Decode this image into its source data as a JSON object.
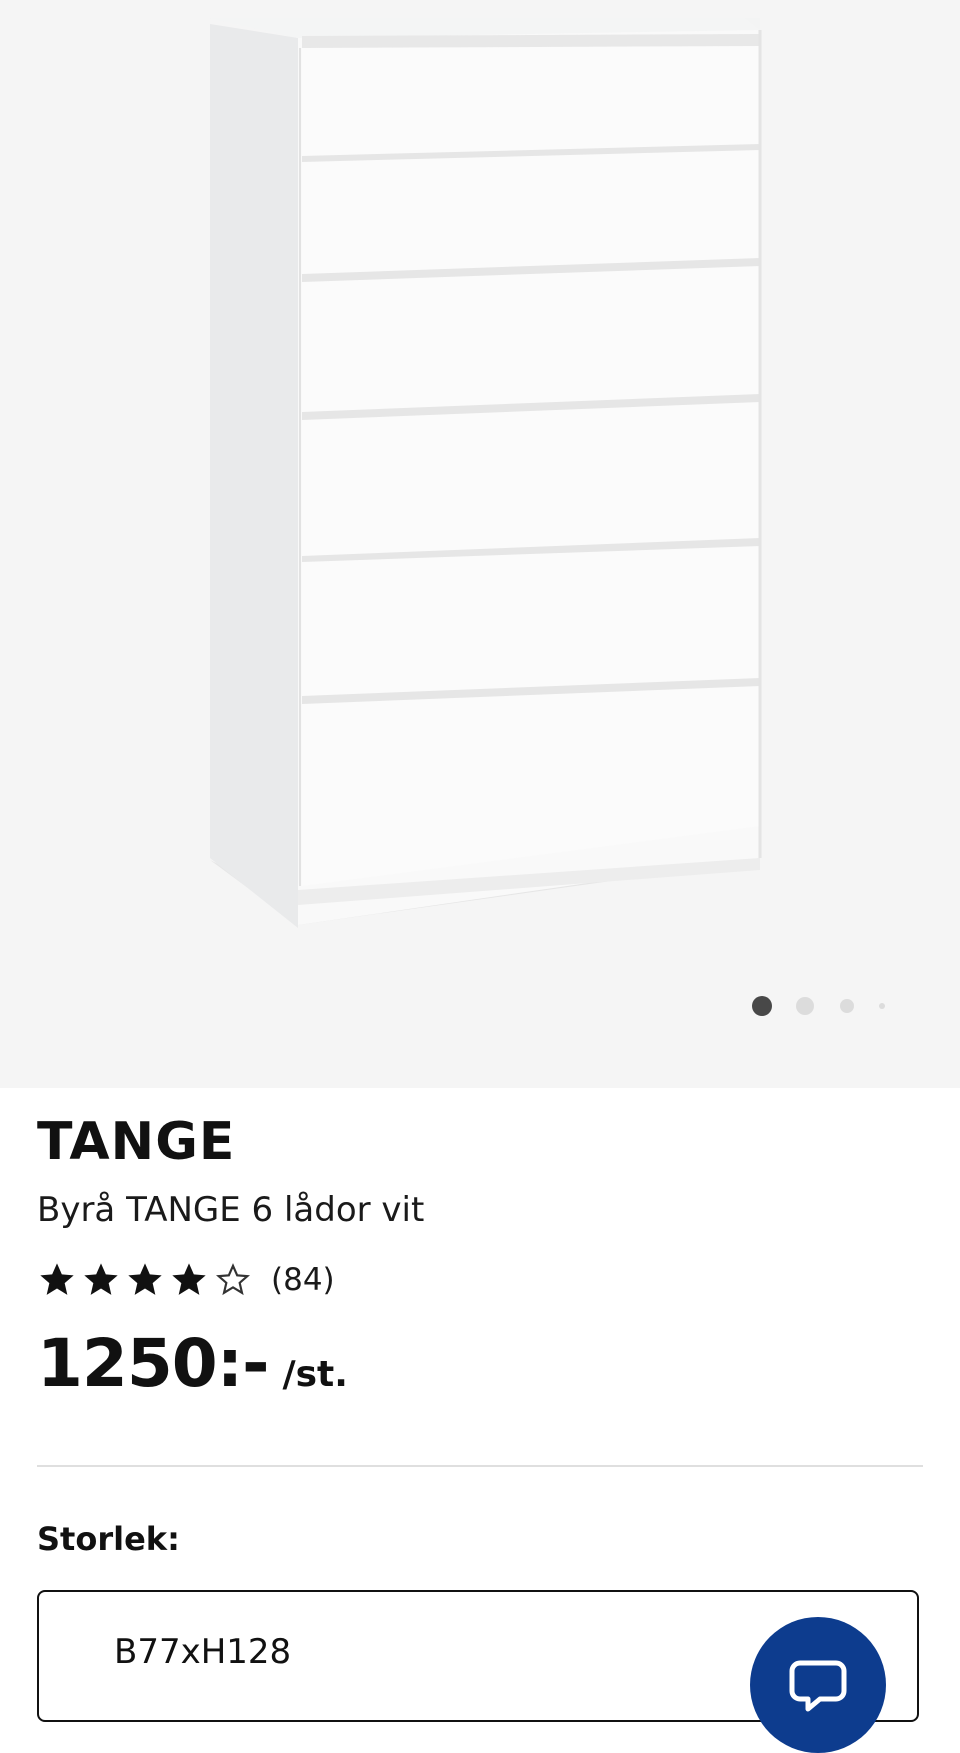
{
  "product": {
    "name": "TANGE",
    "description": "Byrå TANGE 6 lådor vit",
    "rating": 4,
    "rating_max": 5,
    "reviews": "(84)",
    "price": "1250:-",
    "price_unit": "/st."
  },
  "gallery": {
    "image_alt": "Byrå TANGE 6 lådor vit",
    "image_count": 4,
    "active_index": 1,
    "background": "#f5f5f5"
  },
  "size": {
    "label": "Storlek:",
    "selected": "B77xH128"
  },
  "chat": {
    "icon": "chat-bubble-icon",
    "color": "#0d3c8e"
  },
  "icons": {
    "star_filled": "star-filled-icon",
    "star_empty": "star-outline-icon"
  }
}
